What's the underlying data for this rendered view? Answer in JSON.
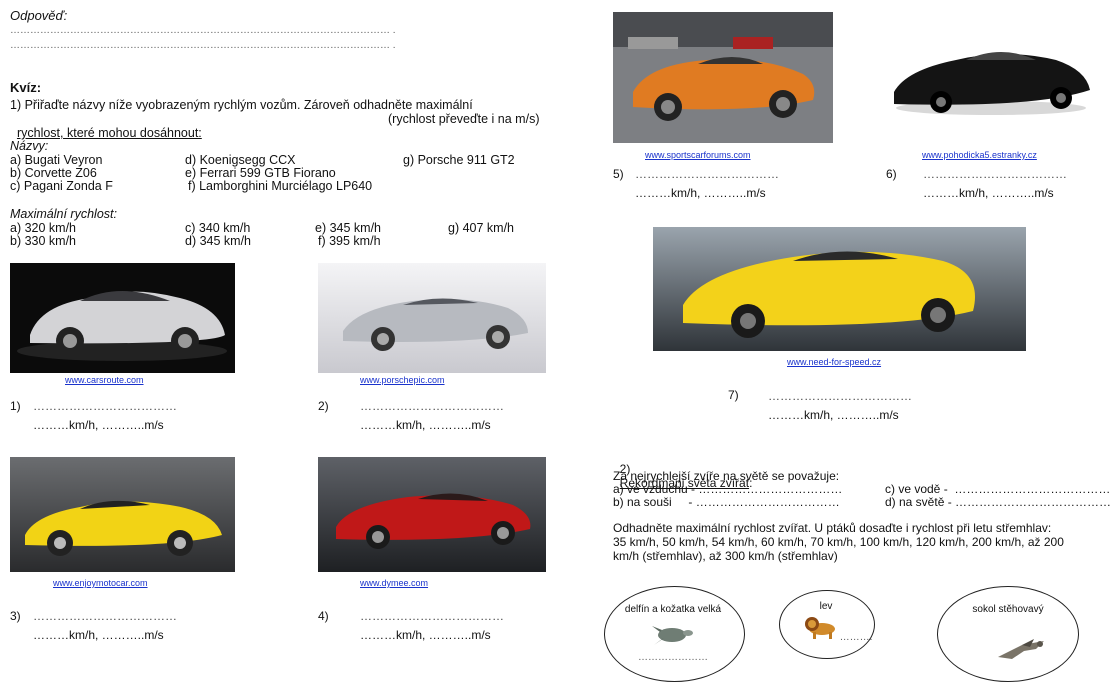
{
  "answer": {
    "label": "Odpověď:",
    "line1": "…………………………………………………………………………………………………… .",
    "line2": "…………………………………………………………………………………………………… ."
  },
  "quiz": {
    "heading": "Kvíz:",
    "task1_line1": "1) Přiřaďte názvy níže vyobrazeným rychlým vozům. Zároveň odhadněte maximální",
    "task1_line2_u": "rychlost, které mohou dosáhnout:",
    "task1_line2_rest": "(rychlost převeďte i na m/s)",
    "names_label": "Názvy:",
    "names": {
      "a": "a) Bugati Veyron",
      "b": "b) Corvette Z06",
      "c": "c) Pagani Zonda F",
      "d": "d) Koenigsegg CCX",
      "e": "e) Ferrari 599 GTB Fiorano",
      "f": "f) Lamborghini Murciélago LP640",
      "g": "g) Porsche 911 GT2"
    },
    "speed_label": "Maximální rychlost:",
    "speeds": {
      "a": "a) 320 km/h",
      "b": "b) 330 km/h",
      "c": "c) 340 km/h",
      "d": "d) 345 km/h",
      "e": "e) 345 km/h",
      "f": "f) 395 km/h",
      "g": "g) 407 km/h"
    }
  },
  "cars": [
    {
      "num": "1)",
      "link": "www.carsroute.com",
      "dots": "………………………………",
      "units": "………km/h, ………..m/s",
      "color": "#c8c8cc"
    },
    {
      "num": "2)",
      "link": "www.porschepic.com",
      "dots": "………………………………",
      "units": "………km/h, ………..m/s",
      "color": "#b9bcc2"
    },
    {
      "num": "3)",
      "link": "www.enjoymotocar.com",
      "dots": "………………………………",
      "units": "………km/h, ………..m/s",
      "color": "#f2d315"
    },
    {
      "num": "4)",
      "link": "www.dymee.com",
      "dots": "………………………………",
      "units": "………km/h, ………..m/s",
      "color": "#c01818"
    },
    {
      "num": "5)",
      "link": "www.sportscarforums.com",
      "dots": "………………………………",
      "units": "………km/h, ………..m/s",
      "color": "#e07b22"
    },
    {
      "num": "6)",
      "link": "www.pohodicka5.estranky.cz",
      "dots": "………………………………",
      "units": "………km/h, ………..m/s",
      "color": "#141414"
    },
    {
      "num": "7)",
      "link": "www.need-for-speed.cz",
      "dots": "………………………………",
      "units": "………km/h, ………..m/s",
      "color": "#f3d21a"
    }
  ],
  "animals": {
    "heading_num": "2)",
    "heading_u": "Rekordmani světa zvířat",
    "heading_colon": ":",
    "intro": "Za nejrychlejší zvíře na světě se považuje:",
    "a": "a) ve vzduchu - ………………………………",
    "b": "b) na souši     - ………………………………",
    "c": "c) ve vodě -  ……………………………………",
    "d": "d) na světě - ……………………………………",
    "estimate1": "Odhadněte maximální rychlost zvířat. U ptáků dosaďte i rychlost při letu střemhlav:",
    "estimate2": "35 km/h, 50 km/h, 54 km/h, 60 km/h, 70 km/h, 100 km/h, 120 km/h, 200 km/h, až 200",
    "estimate3": "km/h (střemhlav), až 300 km/h (střemhlav)",
    "circle1": "delfín a kožatka velká",
    "circle1_dots": "…………………",
    "circle2": "lev",
    "circle2_dots": "……….",
    "circle3": "sokol stěhovavý"
  }
}
